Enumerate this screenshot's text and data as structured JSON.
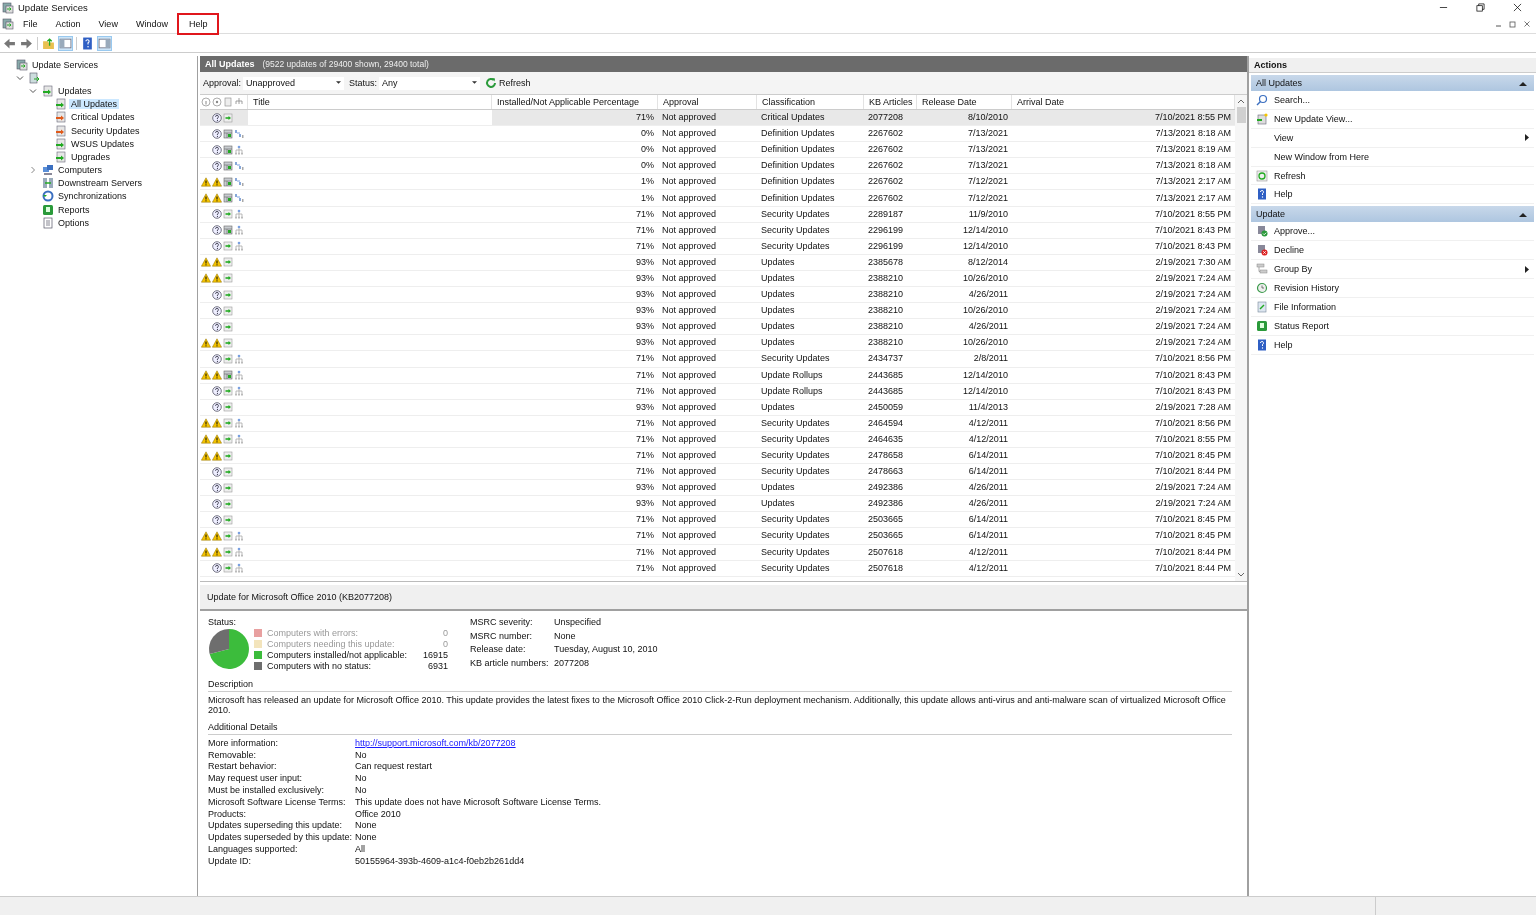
{
  "window": {
    "title": "Update Services"
  },
  "menu": [
    {
      "label": "File",
      "highlighted": false
    },
    {
      "label": "Action",
      "highlighted": false
    },
    {
      "label": "View",
      "highlighted": false
    },
    {
      "label": "Window",
      "highlighted": false
    },
    {
      "label": "Help",
      "highlighted": true
    }
  ],
  "tree": [
    {
      "label": "Update Services",
      "kind": "console",
      "selected": false,
      "children": [
        {
          "kind": "server",
          "selected": false,
          "expanded": true,
          "children": [
            {
              "label": "Updates",
              "kind": "updates",
              "selected": false,
              "expanded": true,
              "children": [
                {
                  "label": "All Updates",
                  "kind": "updates",
                  "selected": true
                },
                {
                  "label": "Critical Updates",
                  "kind": "flagged",
                  "selected": false
                },
                {
                  "label": "Security Updates",
                  "kind": "flagged",
                  "selected": false
                },
                {
                  "label": "WSUS Updates",
                  "kind": "updates",
                  "selected": false
                },
                {
                  "label": "Upgrades",
                  "kind": "updates",
                  "selected": false
                }
              ]
            },
            {
              "label": "Computers",
              "kind": "computers",
              "selected": false,
              "expanded": false
            },
            {
              "label": "Downstream Servers",
              "kind": "servers",
              "selected": false
            },
            {
              "label": "Synchronizations",
              "kind": "sync",
              "selected": false
            },
            {
              "label": "Reports",
              "kind": "reports",
              "selected": false
            },
            {
              "label": "Options",
              "kind": "options",
              "selected": false
            }
          ]
        }
      ]
    }
  ],
  "center": {
    "heading": "All Updates",
    "summary": "(9522 updates of 29400 shown, 29400 total)",
    "filters": [
      {
        "label": "Approval:",
        "value": "Unapproved"
      },
      {
        "label": "Status:",
        "value": "Any"
      }
    ],
    "refresh": "Refresh",
    "columns": [
      "Title",
      "Installed/Not Applicable Percentage",
      "Approval",
      "Classification",
      "KB Articles",
      "Release Date",
      "Arrival Date"
    ],
    "rows": [
      {
        "selected": true,
        "icons": [
          {
            "kind": "unknown"
          },
          {
            "kind": "install"
          }
        ],
        "percent": "71%",
        "approval": "Not approved",
        "classification": "Critical Updates",
        "kb": "2077208",
        "release": "8/10/2010",
        "arrival": "7/10/2021 8:55 PM"
      },
      {
        "selected": false,
        "icons": [
          {
            "kind": "unknown"
          },
          {
            "kind": "package"
          },
          {
            "kind": "arrows"
          }
        ],
        "percent": "0%",
        "approval": "Not approved",
        "classification": "Definition Updates",
        "kb": "2267602",
        "release": "7/13/2021",
        "arrival": "7/13/2021 8:18 AM"
      },
      {
        "selected": false,
        "icons": [
          {
            "kind": "unknown"
          },
          {
            "kind": "package"
          },
          {
            "kind": "tree"
          }
        ],
        "percent": "0%",
        "approval": "Not approved",
        "classification": "Definition Updates",
        "kb": "2267602",
        "release": "7/13/2021",
        "arrival": "7/13/2021 8:19 AM"
      },
      {
        "selected": false,
        "icons": [
          {
            "kind": "unknown"
          },
          {
            "kind": "package"
          },
          {
            "kind": "arrows"
          }
        ],
        "percent": "0%",
        "approval": "Not approved",
        "classification": "Definition Updates",
        "kb": "2267602",
        "release": "7/13/2021",
        "arrival": "7/13/2021 8:18 AM"
      },
      {
        "selected": false,
        "icons": [
          {
            "kind": "warning"
          },
          {
            "kind": "warning"
          },
          {
            "kind": "package"
          },
          {
            "kind": "arrows"
          }
        ],
        "percent": "1%",
        "approval": "Not approved",
        "classification": "Definition Updates",
        "kb": "2267602",
        "release": "7/12/2021",
        "arrival": "7/13/2021 2:17 AM"
      },
      {
        "selected": false,
        "icons": [
          {
            "kind": "warning"
          },
          {
            "kind": "warning"
          },
          {
            "kind": "package"
          },
          {
            "kind": "arrows"
          }
        ],
        "percent": "1%",
        "approval": "Not approved",
        "classification": "Definition Updates",
        "kb": "2267602",
        "release": "7/12/2021",
        "arrival": "7/13/2021 2:17 AM"
      },
      {
        "selected": false,
        "icons": [
          {
            "kind": "unknown"
          },
          {
            "kind": "install"
          },
          {
            "kind": "tree"
          }
        ],
        "percent": "71%",
        "approval": "Not approved",
        "classification": "Security Updates",
        "kb": "2289187",
        "release": "11/9/2010",
        "arrival": "7/10/2021 8:55 PM"
      },
      {
        "selected": false,
        "icons": [
          {
            "kind": "unknown"
          },
          {
            "kind": "package"
          },
          {
            "kind": "tree"
          }
        ],
        "percent": "71%",
        "approval": "Not approved",
        "classification": "Security Updates",
        "kb": "2296199",
        "release": "12/14/2010",
        "arrival": "7/10/2021 8:43 PM"
      },
      {
        "selected": false,
        "icons": [
          {
            "kind": "unknown"
          },
          {
            "kind": "install"
          },
          {
            "kind": "tree"
          }
        ],
        "percent": "71%",
        "approval": "Not approved",
        "classification": "Security Updates",
        "kb": "2296199",
        "release": "12/14/2010",
        "arrival": "7/10/2021 8:43 PM"
      },
      {
        "selected": false,
        "icons": [
          {
            "kind": "warning"
          },
          {
            "kind": "warning"
          },
          {
            "kind": "install"
          }
        ],
        "percent": "93%",
        "approval": "Not approved",
        "classification": "Updates",
        "kb": "2385678",
        "release": "8/12/2014",
        "arrival": "2/19/2021 7:30 AM"
      },
      {
        "selected": false,
        "icons": [
          {
            "kind": "warning"
          },
          {
            "kind": "warning"
          },
          {
            "kind": "install"
          }
        ],
        "percent": "93%",
        "approval": "Not approved",
        "classification": "Updates",
        "kb": "2388210",
        "release": "10/26/2010",
        "arrival": "2/19/2021 7:24 AM"
      },
      {
        "selected": false,
        "icons": [
          {
            "kind": "unknown"
          },
          {
            "kind": "install"
          }
        ],
        "percent": "93%",
        "approval": "Not approved",
        "classification": "Updates",
        "kb": "2388210",
        "release": "4/26/2011",
        "arrival": "2/19/2021 7:24 AM"
      },
      {
        "selected": false,
        "icons": [
          {
            "kind": "unknown"
          },
          {
            "kind": "install"
          }
        ],
        "percent": "93%",
        "approval": "Not approved",
        "classification": "Updates",
        "kb": "2388210",
        "release": "10/26/2010",
        "arrival": "2/19/2021 7:24 AM"
      },
      {
        "selected": false,
        "icons": [
          {
            "kind": "unknown"
          },
          {
            "kind": "install"
          }
        ],
        "percent": "93%",
        "approval": "Not approved",
        "classification": "Updates",
        "kb": "2388210",
        "release": "4/26/2011",
        "arrival": "2/19/2021 7:24 AM"
      },
      {
        "selected": false,
        "icons": [
          {
            "kind": "warning"
          },
          {
            "kind": "warning"
          },
          {
            "kind": "install"
          }
        ],
        "percent": "93%",
        "approval": "Not approved",
        "classification": "Updates",
        "kb": "2388210",
        "release": "10/26/2010",
        "arrival": "2/19/2021 7:24 AM"
      },
      {
        "selected": false,
        "icons": [
          {
            "kind": "unknown"
          },
          {
            "kind": "install"
          },
          {
            "kind": "tree"
          }
        ],
        "percent": "71%",
        "approval": "Not approved",
        "classification": "Security Updates",
        "kb": "2434737",
        "release": "2/8/2011",
        "arrival": "7/10/2021 8:56 PM"
      },
      {
        "selected": false,
        "icons": [
          {
            "kind": "warning"
          },
          {
            "kind": "warning"
          },
          {
            "kind": "package"
          },
          {
            "kind": "tree"
          }
        ],
        "percent": "71%",
        "approval": "Not approved",
        "classification": "Update Rollups",
        "kb": "2443685",
        "release": "12/14/2010",
        "arrival": "7/10/2021 8:43 PM"
      },
      {
        "selected": false,
        "icons": [
          {
            "kind": "unknown"
          },
          {
            "kind": "install"
          },
          {
            "kind": "tree"
          }
        ],
        "percent": "71%",
        "approval": "Not approved",
        "classification": "Update Rollups",
        "kb": "2443685",
        "release": "12/14/2010",
        "arrival": "7/10/2021 8:43 PM"
      },
      {
        "selected": false,
        "icons": [
          {
            "kind": "unknown"
          },
          {
            "kind": "install"
          }
        ],
        "percent": "93%",
        "approval": "Not approved",
        "classification": "Updates",
        "kb": "2450059",
        "release": "11/4/2013",
        "arrival": "2/19/2021 7:28 AM"
      },
      {
        "selected": false,
        "icons": [
          {
            "kind": "warning"
          },
          {
            "kind": "warning"
          },
          {
            "kind": "install"
          },
          {
            "kind": "tree"
          }
        ],
        "percent": "71%",
        "approval": "Not approved",
        "classification": "Security Updates",
        "kb": "2464594",
        "release": "4/12/2011",
        "arrival": "7/10/2021 8:56 PM"
      },
      {
        "selected": false,
        "icons": [
          {
            "kind": "warning"
          },
          {
            "kind": "warning"
          },
          {
            "kind": "install"
          },
          {
            "kind": "tree"
          }
        ],
        "percent": "71%",
        "approval": "Not approved",
        "classification": "Security Updates",
        "kb": "2464635",
        "release": "4/12/2011",
        "arrival": "7/10/2021 8:55 PM"
      },
      {
        "selected": false,
        "icons": [
          {
            "kind": "warning"
          },
          {
            "kind": "warning"
          },
          {
            "kind": "install"
          }
        ],
        "percent": "71%",
        "approval": "Not approved",
        "classification": "Security Updates",
        "kb": "2478658",
        "release": "6/14/2011",
        "arrival": "7/10/2021 8:45 PM"
      },
      {
        "selected": false,
        "icons": [
          {
            "kind": "unknown"
          },
          {
            "kind": "install"
          }
        ],
        "percent": "71%",
        "approval": "Not approved",
        "classification": "Security Updates",
        "kb": "2478663",
        "release": "6/14/2011",
        "arrival": "7/10/2021 8:44 PM"
      },
      {
        "selected": false,
        "icons": [
          {
            "kind": "unknown"
          },
          {
            "kind": "install"
          }
        ],
        "percent": "93%",
        "approval": "Not approved",
        "classification": "Updates",
        "kb": "2492386",
        "release": "4/26/2011",
        "arrival": "2/19/2021 7:24 AM"
      },
      {
        "selected": false,
        "icons": [
          {
            "kind": "unknown"
          },
          {
            "kind": "install"
          }
        ],
        "percent": "93%",
        "approval": "Not approved",
        "classification": "Updates",
        "kb": "2492386",
        "release": "4/26/2011",
        "arrival": "2/19/2021 7:24 AM"
      },
      {
        "selected": false,
        "icons": [
          {
            "kind": "unknown"
          },
          {
            "kind": "install"
          }
        ],
        "percent": "71%",
        "approval": "Not approved",
        "classification": "Security Updates",
        "kb": "2503665",
        "release": "6/14/2011",
        "arrival": "7/10/2021 8:45 PM"
      },
      {
        "selected": false,
        "icons": [
          {
            "kind": "warning"
          },
          {
            "kind": "warning"
          },
          {
            "kind": "install"
          },
          {
            "kind": "tree"
          }
        ],
        "percent": "71%",
        "approval": "Not approved",
        "classification": "Security Updates",
        "kb": "2503665",
        "release": "6/14/2011",
        "arrival": "7/10/2021 8:45 PM"
      },
      {
        "selected": false,
        "icons": [
          {
            "kind": "warning"
          },
          {
            "kind": "warning"
          },
          {
            "kind": "install"
          },
          {
            "kind": "tree"
          }
        ],
        "percent": "71%",
        "approval": "Not approved",
        "classification": "Security Updates",
        "kb": "2507618",
        "release": "4/12/2011",
        "arrival": "7/10/2021 8:44 PM"
      },
      {
        "selected": false,
        "icons": [
          {
            "kind": "unknown"
          },
          {
            "kind": "install"
          },
          {
            "kind": "tree"
          }
        ],
        "percent": "71%",
        "approval": "Not approved",
        "classification": "Security Updates",
        "kb": "2507618",
        "release": "4/12/2011",
        "arrival": "7/10/2021 8:44 PM"
      }
    ]
  },
  "details": {
    "title": "Update for Microsoft Office 2010 (KB2077208)",
    "status_label": "Status:",
    "legend": [
      {
        "label": "Computers with errors:",
        "count": "0",
        "color": "#e8a0a0"
      },
      {
        "label": "Computers needing this update:",
        "count": "0",
        "color": "#f3e4bc"
      },
      {
        "label": "Computers installed/not applicable:",
        "count": "16915",
        "color": "#3cbc3c"
      },
      {
        "label": "Computers with no status:",
        "count": "6931",
        "color": "#6e6e6e"
      }
    ],
    "fields": [
      {
        "label": "MSRC severity:",
        "value": "Unspecified"
      },
      {
        "label": "MSRC number:",
        "value": "None"
      },
      {
        "label": "Release date:",
        "value": "Tuesday, August 10, 2010"
      },
      {
        "label": "KB article numbers:",
        "value": "2077208"
      }
    ],
    "description_heading": "Description",
    "description": "Microsoft has released an update for Microsoft Office 2010. This update provides the latest fixes to the Microsoft Office 2010 Click-2-Run deployment mechanism. Additionally, this update allows anti-virus and anti-malware scan of virtualized Microsoft Office 2010.",
    "additional_heading": "Additional Details",
    "additional": [
      {
        "label": "More information:",
        "value": "http://support.microsoft.com/kb/2077208",
        "kind": "link"
      },
      {
        "label": "Removable:",
        "value": "No",
        "kind": "text"
      },
      {
        "label": "Restart behavior:",
        "value": "Can request restart",
        "kind": "text"
      },
      {
        "label": "May request user input:",
        "value": "No",
        "kind": "text"
      },
      {
        "label": "Must be installed exclusively:",
        "value": "No",
        "kind": "text"
      },
      {
        "label": "Microsoft Software License Terms:",
        "value": "This update does not have Microsoft Software License Terms.",
        "kind": "text"
      },
      {
        "label": "Products:",
        "value": "Office 2010",
        "kind": "text"
      },
      {
        "label": "Updates superseding this update:",
        "value": "None",
        "kind": "text"
      },
      {
        "label": "Updates superseded by this update:",
        "value": "None",
        "kind": "text"
      },
      {
        "label": "Languages supported:",
        "value": "All",
        "kind": "text"
      },
      {
        "label": "Update ID:",
        "value": "50155964-393b-4609-a1c4-f0eb2b261dd4",
        "kind": "text"
      }
    ]
  },
  "actions": {
    "title": "Actions",
    "sections": [
      {
        "title": "All Updates",
        "expanded": true,
        "items": [
          {
            "label": "Search...",
            "kind": "search",
            "submenu": false
          },
          {
            "label": "New Update View...",
            "kind": "new-view",
            "submenu": false
          },
          {
            "label": "View",
            "kind": "blank",
            "submenu": true
          },
          {
            "label": "New Window from Here",
            "kind": "blank",
            "submenu": false
          },
          {
            "label": "Refresh",
            "kind": "refresh",
            "submenu": false
          },
          {
            "label": "Help",
            "kind": "help",
            "submenu": false
          }
        ]
      },
      {
        "title": "Update",
        "expanded": true,
        "items": [
          {
            "label": "Approve...",
            "kind": "approve",
            "submenu": false
          },
          {
            "label": "Decline",
            "kind": "decline",
            "submenu": false
          },
          {
            "label": "Group By",
            "kind": "group",
            "submenu": true
          },
          {
            "label": "Revision History",
            "kind": "history",
            "submenu": false
          },
          {
            "label": "File Information",
            "kind": "file",
            "submenu": false
          },
          {
            "label": "Status Report",
            "kind": "report",
            "submenu": false
          },
          {
            "label": "Help",
            "kind": "help",
            "submenu": false
          }
        ]
      }
    ]
  }
}
